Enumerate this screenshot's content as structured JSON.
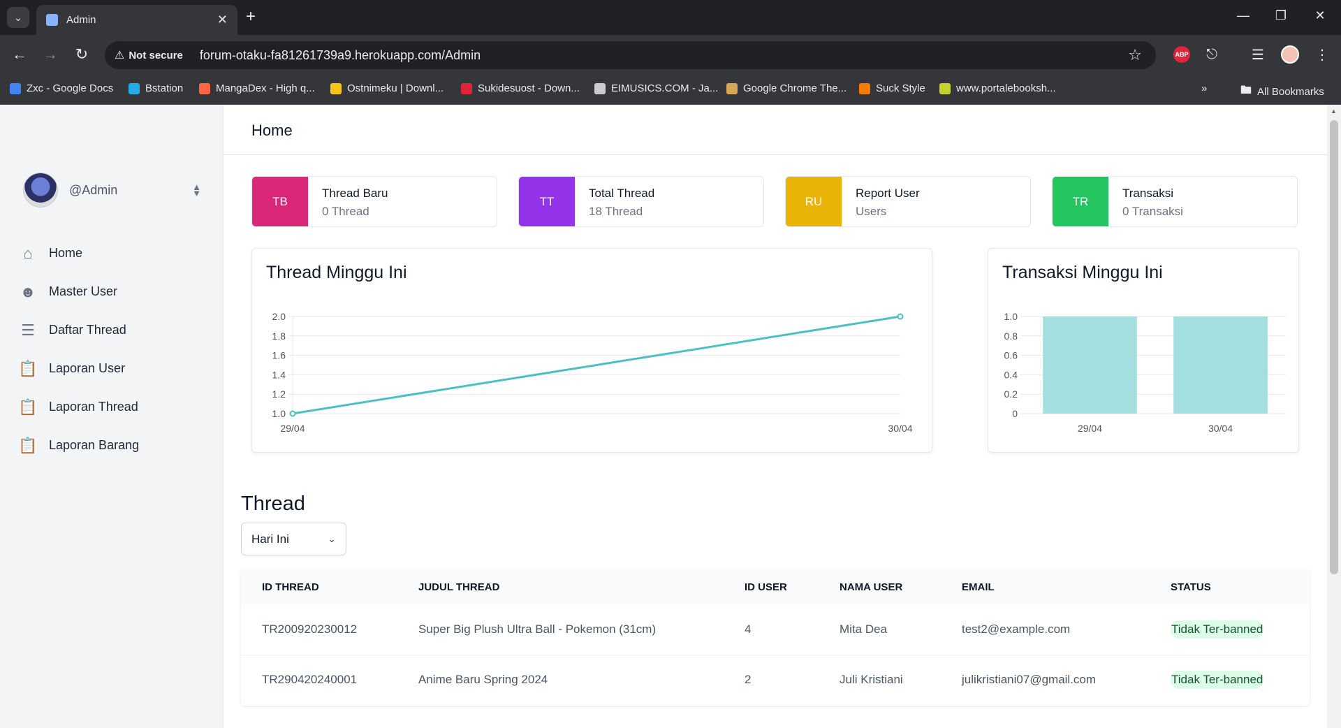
{
  "browser": {
    "tab_title": "Admin",
    "not_secure_label": "Not secure",
    "url": "forum-otaku-fa81261739a9.herokuapp.com/Admin",
    "bookmarks": [
      {
        "label": "Zxc - Google Docs",
        "color": "#4285f4"
      },
      {
        "label": "Bstation",
        "color": "#23ade5"
      },
      {
        "label": "MangaDex - High q...",
        "color": "#ff6740"
      },
      {
        "label": "Ostnimeku | Downl...",
        "color": "#f5c518"
      },
      {
        "label": "Sukidesuost - Down...",
        "color": "#e0243b"
      },
      {
        "label": "EIMUSICS.COM - Ja...",
        "color": "#cccccc"
      },
      {
        "label": "Google Chrome The...",
        "color": "#d8a657"
      },
      {
        "label": "Suck Style",
        "color": "#f57c00"
      },
      {
        "label": "www.portalebooksh...",
        "color": "#c5d22b"
      }
    ],
    "all_bookmarks_label": "All Bookmarks"
  },
  "sidebar": {
    "username": "@Admin",
    "menu": [
      {
        "label": "Home",
        "icon": "home-icon"
      },
      {
        "label": "Master User",
        "icon": "users-icon"
      },
      {
        "label": "Daftar Thread",
        "icon": "list-icon"
      },
      {
        "label": "Laporan User",
        "icon": "clipboard-icon"
      },
      {
        "label": "Laporan Thread",
        "icon": "clipboard-icon"
      },
      {
        "label": "Laporan Barang",
        "icon": "clipboard-icon"
      }
    ]
  },
  "header": {
    "title": "Home"
  },
  "stats": [
    {
      "badge": "TB",
      "title": "Thread Baru",
      "value": "0 Thread",
      "color": "#db2777"
    },
    {
      "badge": "TT",
      "title": "Total Thread",
      "value": "18 Thread",
      "color": "#9333ea"
    },
    {
      "badge": "RU",
      "title": "Report User",
      "value": "Users",
      "color": "#eab308"
    },
    {
      "badge": "TR",
      "title": "Transaksi",
      "value": "0 Transaksi",
      "color": "#22c55e"
    }
  ],
  "chart_data": [
    {
      "type": "line",
      "title": "Thread Minggu Ini",
      "categories": [
        "29/04",
        "30/04"
      ],
      "values": [
        1,
        2
      ],
      "ylim": [
        1,
        2
      ],
      "yticks": [
        "1.0",
        "1.2",
        "1.4",
        "1.6",
        "1.8",
        "2.0"
      ],
      "color": "#4bc0c0",
      "grid": true
    },
    {
      "type": "bar",
      "title": "Transaksi Minggu Ini",
      "categories": [
        "29/04",
        "30/04"
      ],
      "values": [
        1,
        1
      ],
      "ylim": [
        0,
        1
      ],
      "yticks": [
        "0",
        "0.2",
        "0.4",
        "0.6",
        "0.8",
        "1.0"
      ],
      "color": "#a4dfdf",
      "grid": true
    }
  ],
  "thread_section": {
    "title": "Thread",
    "filter_value": "Hari Ini",
    "columns": [
      "ID THREAD",
      "JUDUL THREAD",
      "ID USER",
      "NAMA USER",
      "EMAIL",
      "STATUS"
    ],
    "rows": [
      [
        "TR200920230012",
        "Super Big Plush Ultra Ball - Pokemon (31cm)",
        "4",
        "Mita Dea",
        "test2@example.com",
        "Tidak Ter-banned"
      ],
      [
        "TR290420240001",
        "Anime Baru Spring 2024",
        "2",
        "Juli Kristiani",
        "julikristiani07@gmail.com",
        "Tidak Ter-banned"
      ]
    ]
  }
}
